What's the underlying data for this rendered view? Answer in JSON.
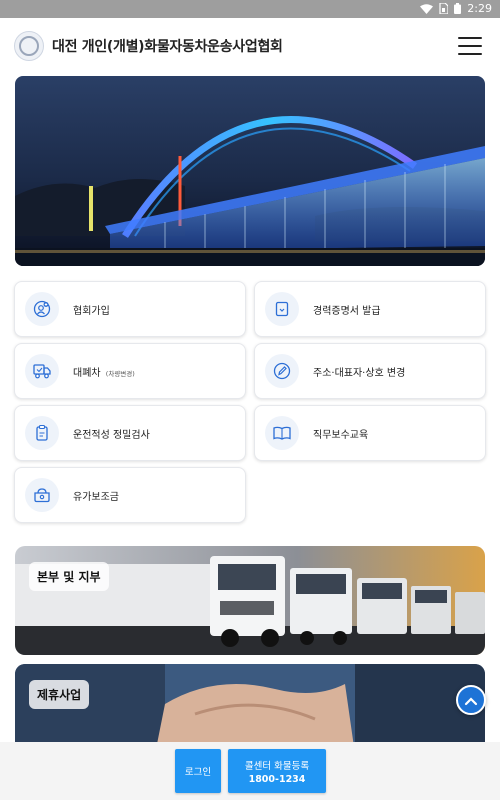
{
  "status_bar": {
    "time": "2:29",
    "icons": [
      "wifi-icon",
      "sim-icon",
      "battery-icon"
    ]
  },
  "header": {
    "title": "대전 개인(개별)화물자동차운송사업협회",
    "menu_icon": "hamburger-menu-icon"
  },
  "hero": {
    "image": "night bridge with fountain lights"
  },
  "menu": [
    {
      "label": "협회가입",
      "icon": "user-add-icon"
    },
    {
      "label": "경력증명서 발급",
      "icon": "document-icon"
    },
    {
      "label": "대폐차",
      "sub": "(차량변경)",
      "icon": "truck-icon"
    },
    {
      "label": "주소·대표자·상호 변경",
      "icon": "pencil-icon"
    },
    {
      "label": "운전적성 정밀검사",
      "icon": "clipboard-icon"
    },
    {
      "label": "직무보수교육",
      "icon": "book-icon"
    },
    {
      "label": "유가보조금",
      "icon": "fuel-subsidy-icon"
    }
  ],
  "banners": [
    {
      "label": "본부 및 지부",
      "image": "trucks"
    },
    {
      "label": "제휴사업",
      "image": "handshake"
    }
  ],
  "bottom": {
    "login_label": "로그인",
    "call_label": "콜센터 화물등록",
    "call_number": "1800-1234"
  },
  "colors": {
    "accent": "#2196f3",
    "scroll_button": "#1e73d6"
  }
}
